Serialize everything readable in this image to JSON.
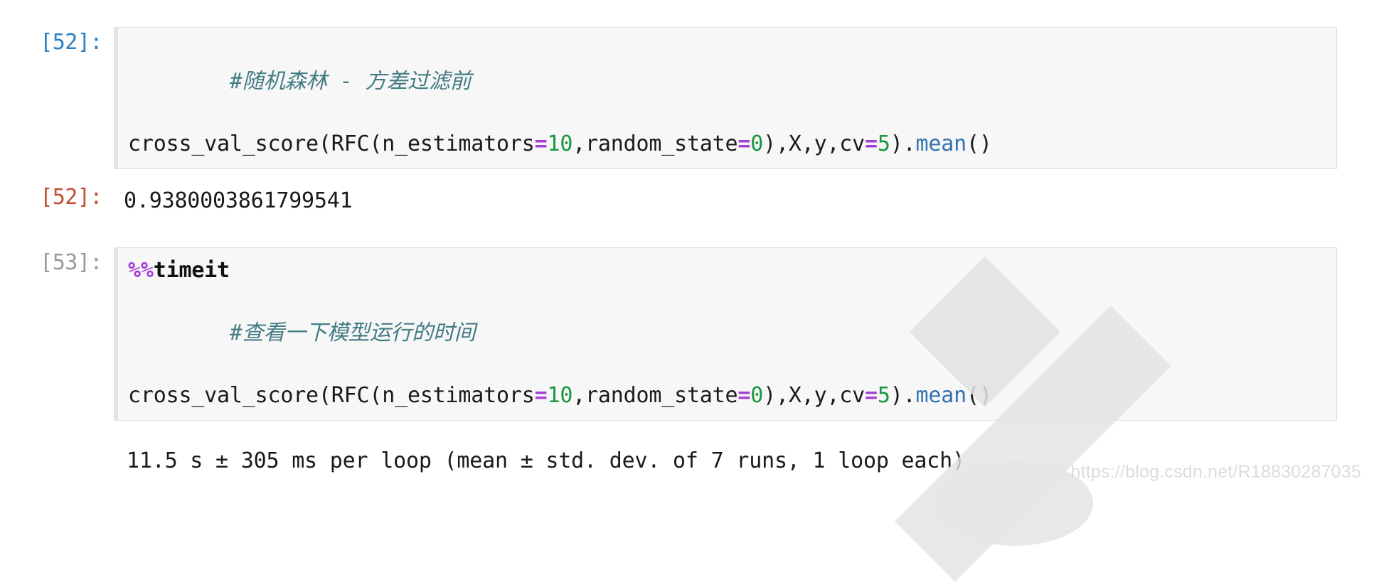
{
  "notebook": {
    "cells": [
      {
        "type": "code",
        "prompt_in": "[52]:",
        "prompt_state": "active",
        "source_lines": [
          {
            "tokens": [
              {
                "t": "comment",
                "v": "#随机森林 - 方差过滤前"
              }
            ]
          },
          {
            "tokens": [
              {
                "t": "plain",
                "v": "cross_val_score(RFC(n_estimators"
              },
              {
                "t": "op",
                "v": "="
              },
              {
                "t": "num",
                "v": "10"
              },
              {
                "t": "plain",
                "v": ",random_state"
              },
              {
                "t": "op",
                "v": "="
              },
              {
                "t": "num",
                "v": "0"
              },
              {
                "t": "plain",
                "v": "),X,y,cv"
              },
              {
                "t": "op",
                "v": "="
              },
              {
                "t": "num",
                "v": "5"
              },
              {
                "t": "plain",
                "v": ")."
              },
              {
                "t": "method",
                "v": "mean"
              },
              {
                "t": "plain",
                "v": "()"
              }
            ]
          }
        ],
        "output": {
          "kind": "execute_result",
          "prompt_out": "[52]:",
          "text": "0.9380003861799541"
        }
      },
      {
        "type": "code",
        "prompt_in": "[53]:",
        "prompt_state": "idle",
        "source_lines": [
          {
            "tokens": [
              {
                "t": "magic-sym",
                "v": "%%"
              },
              {
                "t": "magic",
                "v": "timeit"
              }
            ]
          },
          {
            "tokens": [
              {
                "t": "comment",
                "v": "#查看一下模型运行的时间"
              }
            ]
          },
          {
            "tokens": [
              {
                "t": "plain",
                "v": "cross_val_score(RFC(n_estimators"
              },
              {
                "t": "op",
                "v": "="
              },
              {
                "t": "num",
                "v": "10"
              },
              {
                "t": "plain",
                "v": ",random_state"
              },
              {
                "t": "op",
                "v": "="
              },
              {
                "t": "num",
                "v": "0"
              },
              {
                "t": "plain",
                "v": "),X,y,cv"
              },
              {
                "t": "op",
                "v": "="
              },
              {
                "t": "num",
                "v": "5"
              },
              {
                "t": "plain",
                "v": ")."
              },
              {
                "t": "method",
                "v": "mean"
              },
              {
                "t": "plain",
                "v": "()"
              }
            ]
          }
        ],
        "output": {
          "kind": "stream",
          "prompt_out": "",
          "text": "11.5 s ± 305 ms per loop (mean ± std. dev. of 7 runs, 1 loop each)"
        }
      }
    ]
  },
  "watermark": {
    "url_text": "https://blog.csdn.net/R18830287035"
  },
  "colors": {
    "cell_background": "#f7f7f7",
    "cell_border": "#e0e0e0",
    "prompt_in_active": "#2c7fc0",
    "prompt_in_idle": "#999999",
    "prompt_out": "#c24f34",
    "comment": "#437c84",
    "operator": "#a63fd9",
    "number": "#1a9641",
    "method": "#3572b0",
    "text": "#1a1a1a",
    "watermark": "#e2e2e2"
  }
}
